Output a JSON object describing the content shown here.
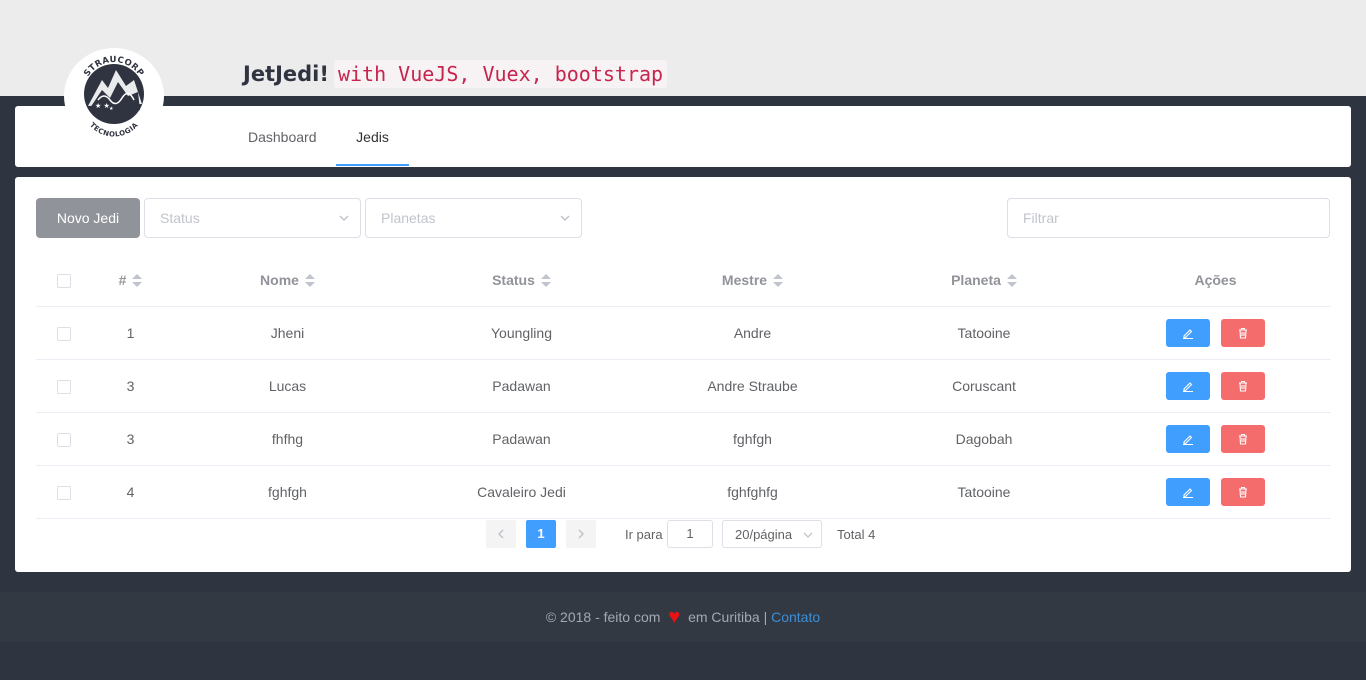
{
  "header": {
    "logo_top_text": "STRAUCORP",
    "logo_bottom_text": "TECNOLOGIA",
    "title": "JetJedi!",
    "subtitle_code": "with VueJS, Vuex, bootstrap"
  },
  "nav": {
    "tabs": [
      {
        "label": "Dashboard",
        "active": false
      },
      {
        "label": "Jedis",
        "active": true
      }
    ]
  },
  "toolbar": {
    "new_button": "Novo Jedi",
    "status_placeholder": "Status",
    "planetas_placeholder": "Planetas",
    "filter_placeholder": "Filtrar"
  },
  "table": {
    "columns": [
      "#",
      "Nome",
      "Status",
      "Mestre",
      "Planeta",
      "Ações"
    ],
    "rows": [
      {
        "id": "1",
        "nome": "Jheni",
        "status": "Youngling",
        "mestre": "Andre",
        "planeta": "Tatooine"
      },
      {
        "id": "3",
        "nome": "Lucas",
        "status": "Padawan",
        "mestre": "Andre Straube",
        "planeta": "Coruscant"
      },
      {
        "id": "3",
        "nome": "fhfhg",
        "status": "Padawan",
        "mestre": "fghfgh",
        "planeta": "Dagobah"
      },
      {
        "id": "4",
        "nome": "fghfgh",
        "status": "Cavaleiro Jedi",
        "mestre": "fghfghfg",
        "planeta": "Tatooine"
      }
    ]
  },
  "pagination": {
    "current_page": "1",
    "goto_label": "Ir para",
    "goto_value": "1",
    "page_size": "20/página",
    "total": "Total 4"
  },
  "footer": {
    "text_before": "© 2018 - feito com",
    "text_after": "em Curitiba |",
    "link": "Contato"
  },
  "colors": {
    "primary": "#409eff",
    "danger": "#f56c6c",
    "info": "#909399",
    "code_text": "#c7254e",
    "dark_bg": "#2e3440"
  }
}
